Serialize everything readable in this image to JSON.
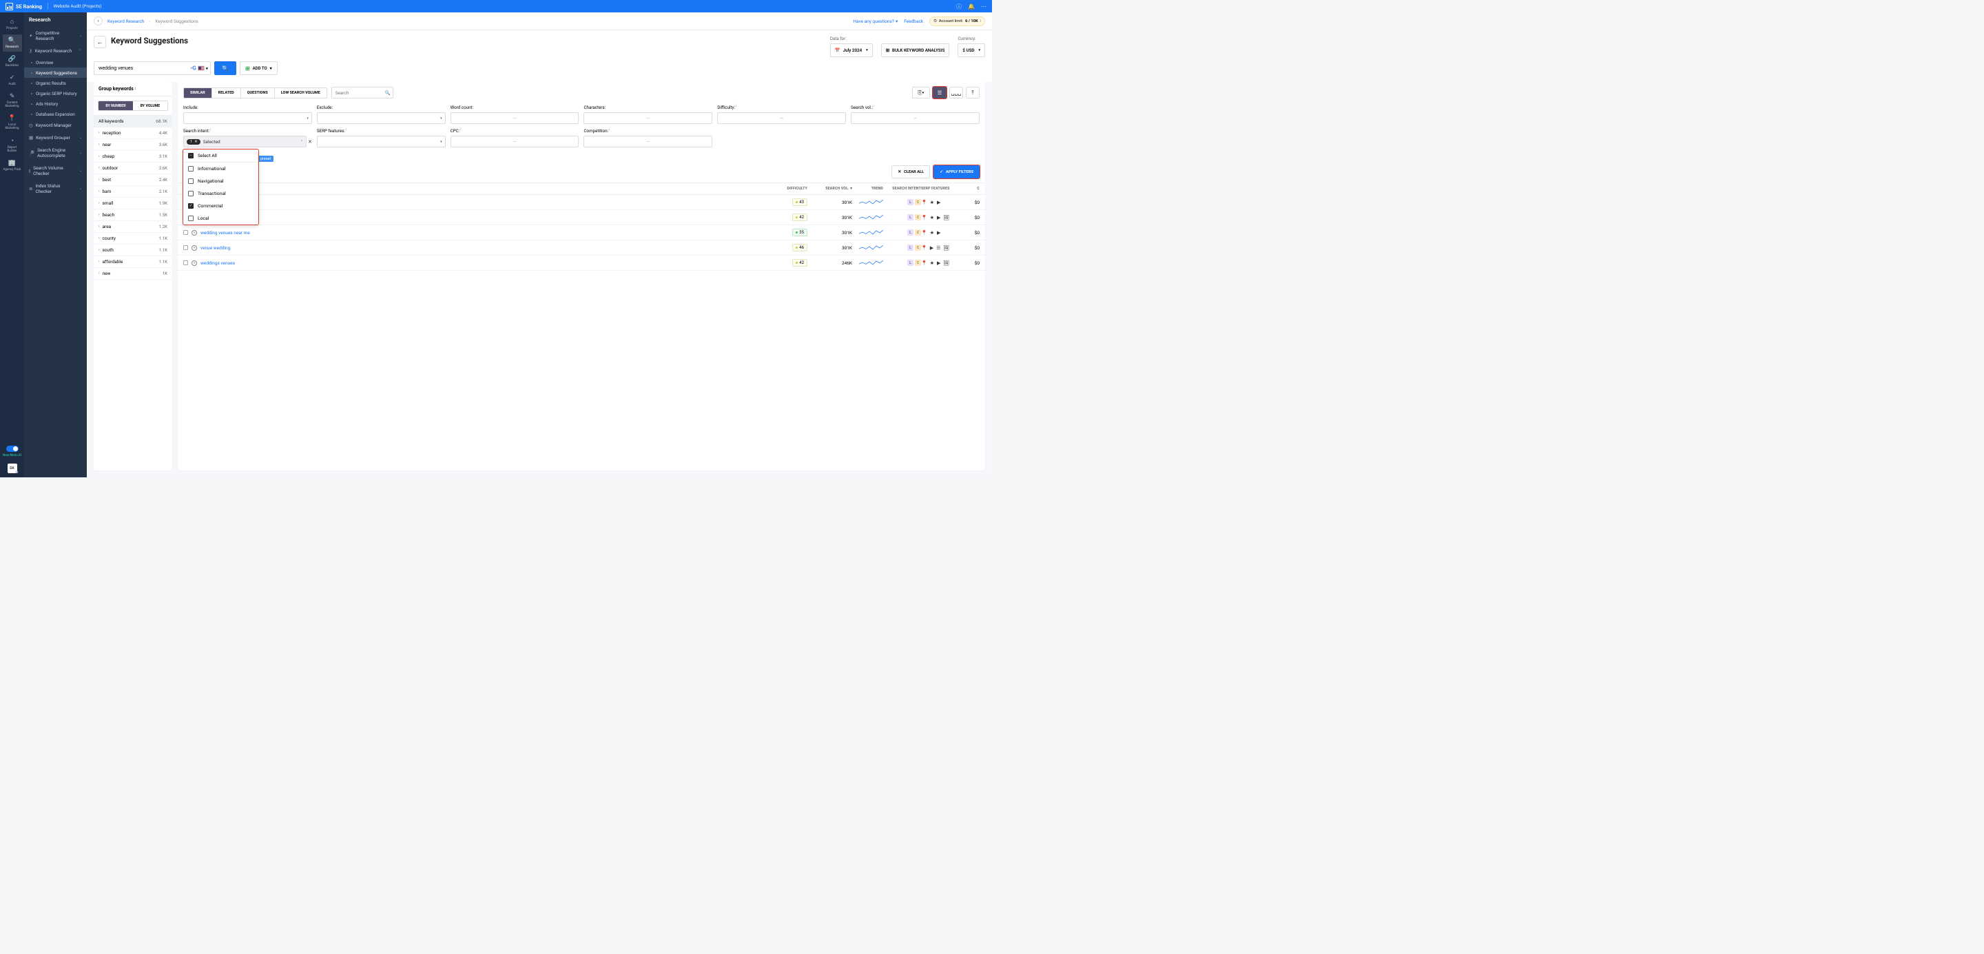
{
  "topbar": {
    "brand": "SE Ranking",
    "context": "Website Audit (Projects)"
  },
  "rail": {
    "projects": "Projects",
    "research": "Research",
    "backlinks": "Backlinks",
    "audit": "Audit",
    "content": "Content Marketing",
    "local": "Local Marketing",
    "report": "Report Builder",
    "agency": "Agency Pack",
    "menu_ui": "New Menu UI",
    "avatar": "DA"
  },
  "sidenav": {
    "header": "Research",
    "competitive": "Competitive Research",
    "keyword_research": "Keyword Research",
    "overview": "Overview",
    "suggestions": "Keyword Suggestions",
    "organic_results": "Organic Results",
    "serp_history": "Organic SERP History",
    "ads_history": "Ads History",
    "db_expansion": "Database Expansion",
    "manager": "Keyword Manager",
    "grouper": "Keyword Grouper",
    "autocomplete": "Search Engine Autocomplete",
    "volume_checker": "Search Volume Checker",
    "index_checker": "Index Status Checker"
  },
  "crumbs": {
    "a": "Keyword Research",
    "b": "Keyword Suggestions",
    "questions": "Have any questions?",
    "feedback": "Feedback",
    "limit_label": "Account limit:",
    "limit_val": "6 / 10K"
  },
  "page": {
    "title": "Keyword Suggestions",
    "data_for": "Data for:",
    "date": "July 2024",
    "bulk": "BULK KEYWORD ANALYSIS",
    "currency_label": "Currency:",
    "currency": "$ USD",
    "keyword": "wedding venues",
    "add_to": "ADD TO"
  },
  "group_panel": {
    "title": "Group keywords",
    "by_number": "BY NUMBER",
    "by_volume": "BY VOLUME",
    "all": "All keywords",
    "all_count": "68.1K",
    "items": [
      {
        "label": "reception",
        "count": "4.4K"
      },
      {
        "label": "near",
        "count": "3.6K"
      },
      {
        "label": "cheap",
        "count": "3.1K"
      },
      {
        "label": "outdoor",
        "count": "2.6K"
      },
      {
        "label": "best",
        "count": "2.4K"
      },
      {
        "label": "barn",
        "count": "2.1K"
      },
      {
        "label": "small",
        "count": "1.9K"
      },
      {
        "label": "beach",
        "count": "1.5K"
      },
      {
        "label": "area",
        "count": "1.2K"
      },
      {
        "label": "county",
        "count": "1.1K"
      },
      {
        "label": "south",
        "count": "1.1K"
      },
      {
        "label": "affordable",
        "count": "1.1K"
      },
      {
        "label": "new",
        "count": "1K"
      }
    ]
  },
  "tabs": {
    "similar": "SIMILAR",
    "related": "RELATED",
    "questions": "QUESTIONS",
    "low": "LOW SEARCH VOLUME"
  },
  "search_placeholder": "Search",
  "filters": {
    "include": "Include:",
    "exclude": "Exclude:",
    "word_count": "Word count:",
    "characters": "Characters:",
    "difficulty": "Difficulty:",
    "search_vol": "Search vol.:",
    "intent": "Search intent:",
    "serp_features": "SERP features:",
    "cpc": "CPC:",
    "competition": "Competition:",
    "selected_count": "1",
    "selected_label": "Selected",
    "clear_all": "CLEAR ALL",
    "apply": "APPLY FILTERS",
    "preset": "preset"
  },
  "intent_options": {
    "select_all": "Select All",
    "informational": "Informational",
    "navigational": "Navigational",
    "transactional": "Transactional",
    "commercial": "Commercial",
    "local": "Local"
  },
  "table": {
    "headers": {
      "difficulty": "DIFFICULTY",
      "search_vol": "SEARCH VOL.",
      "trend": "TREND",
      "intent": "SEARCH INTENT",
      "features": "SERP FEATURES",
      "cost": "C"
    },
    "rows": [
      {
        "kw": "",
        "diff": "43",
        "diff_color": "",
        "sv": "301K",
        "intents": [
          "L",
          "C"
        ],
        "feat": [
          "📍",
          "★",
          "▶"
        ],
        "cost": "$0"
      },
      {
        "kw": "",
        "diff": "42",
        "diff_color": "",
        "sv": "301K",
        "intents": [
          "L",
          "C"
        ],
        "feat": [
          "📍",
          "★",
          "▶",
          "🖼"
        ],
        "cost": "$0"
      },
      {
        "kw": "wedding venues near me",
        "diff": "35",
        "diff_color": "green",
        "sv": "301K",
        "intents": [
          "L",
          "C"
        ],
        "feat": [
          "📍",
          "★",
          "▶"
        ],
        "cost": "$0"
      },
      {
        "kw": "venue wedding",
        "diff": "46",
        "diff_color": "",
        "sv": "301K",
        "intents": [
          "L",
          "C"
        ],
        "feat": [
          "📍",
          "▶",
          "☰",
          "🖼"
        ],
        "cost": "$0"
      },
      {
        "kw": "weddings venues",
        "diff": "42",
        "diff_color": "",
        "sv": "246K",
        "intents": [
          "L",
          "C"
        ],
        "feat": [
          "📍",
          "★",
          "▶",
          "🖼"
        ],
        "cost": "$0"
      }
    ]
  }
}
